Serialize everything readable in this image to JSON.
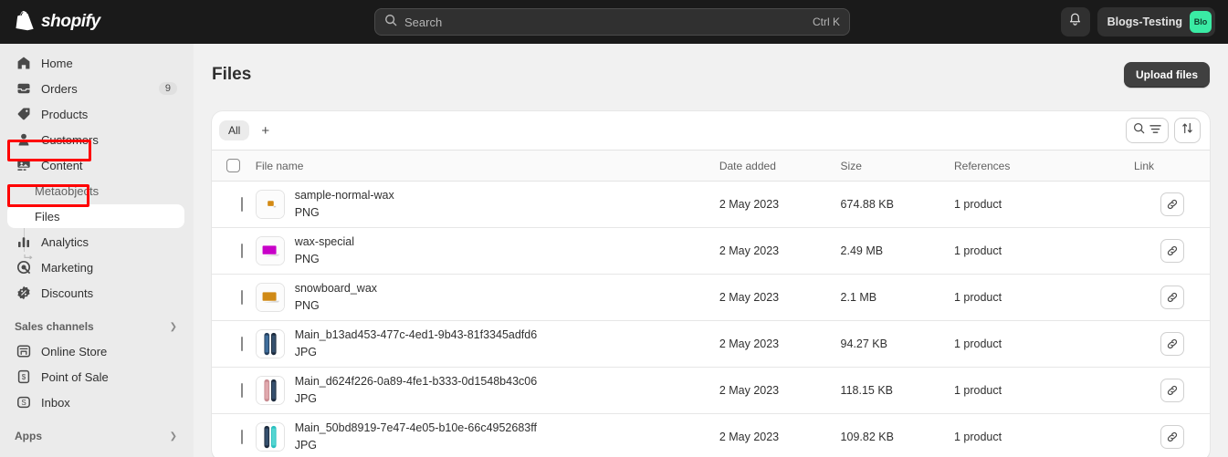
{
  "topbar": {
    "brand": "shopify",
    "brand_icon": "shopify-bag-icon",
    "search": {
      "placeholder": "Search",
      "shortcut": "Ctrl K",
      "icon": "search-icon"
    },
    "notifications_icon": "bell-icon",
    "store_name": "Blogs-Testing",
    "avatar_initials": "Blo",
    "avatar_color": "#3aeba4"
  },
  "sidebar": {
    "items": [
      {
        "label": "Home",
        "icon": "home-icon",
        "badge": ""
      },
      {
        "label": "Orders",
        "icon": "orders-inbox-icon",
        "badge": "9"
      },
      {
        "label": "Products",
        "icon": "products-tag-icon",
        "badge": ""
      },
      {
        "label": "Customers",
        "icon": "customers-person-icon",
        "badge": ""
      },
      {
        "label": "Content",
        "icon": "content-media-icon",
        "badge": ""
      }
    ],
    "content_children": [
      {
        "label": "Metaobjects"
      },
      {
        "label": "Files"
      }
    ],
    "items_after": [
      {
        "label": "Analytics",
        "icon": "analytics-bars-icon",
        "badge": ""
      },
      {
        "label": "Marketing",
        "icon": "marketing-target-icon",
        "badge": ""
      },
      {
        "label": "Discounts",
        "icon": "discounts-badge-icon",
        "badge": ""
      }
    ],
    "sales_channels": {
      "label": "Sales channels",
      "chevron": "chevron-right-icon",
      "items": [
        {
          "label": "Online Store",
          "icon": "online-store-icon"
        },
        {
          "label": "Point of Sale",
          "icon": "point-of-sale-icon"
        },
        {
          "label": "Inbox",
          "icon": "inbox-app-icon"
        }
      ]
    },
    "apps": {
      "label": "Apps",
      "chevron": "chevron-right-icon"
    }
  },
  "main": {
    "page_title": "Files",
    "upload_button": "Upload files",
    "tabs": [
      {
        "label": "All",
        "selected": true
      }
    ],
    "add_tab_icon": "plus-icon",
    "search_filter_icon": "search-filter-icon",
    "sort_icon": "sort-arrows-icon",
    "columns": [
      "File name",
      "Date added",
      "Size",
      "References",
      "Link"
    ],
    "link_row_icon": "chain-link-icon",
    "rows": [
      {
        "name": "sample-normal-wax",
        "type": "PNG",
        "date": "2 May 2023",
        "size": "674.88 KB",
        "refs": "1 product",
        "thumb": "wax-block-small-orange"
      },
      {
        "name": "wax-special",
        "type": "PNG",
        "date": "2 May 2023",
        "size": "2.49 MB",
        "refs": "1 product",
        "thumb": "wax-block-magenta"
      },
      {
        "name": "snowboard_wax",
        "type": "PNG",
        "date": "2 May 2023",
        "size": "2.1 MB",
        "refs": "1 product",
        "thumb": "wax-block-orange"
      },
      {
        "name": "Main_b13ad453-477c-4ed1-9b43-81f3345adfd6",
        "type": "JPG",
        "date": "2 May 2023",
        "size": "94.27 KB",
        "refs": "1 product",
        "thumb": "snowboard-pair-blue"
      },
      {
        "name": "Main_d624f226-0a89-4fe1-b333-0d1548b43c06",
        "type": "JPG",
        "date": "2 May 2023",
        "size": "118.15 KB",
        "refs": "1 product",
        "thumb": "snowboard-pair-pink"
      },
      {
        "name": "Main_50bd8919-7e47-4e05-b10e-66c4952683ff",
        "type": "JPG",
        "date": "2 May 2023",
        "size": "109.82 KB",
        "refs": "1 product",
        "thumb": "snowboard-pair-teal"
      }
    ]
  },
  "annotations": {
    "color": "#ff0000",
    "boxes": [
      {
        "target": "sidebar-item-content"
      },
      {
        "target": "sidebar-item-files"
      }
    ]
  }
}
